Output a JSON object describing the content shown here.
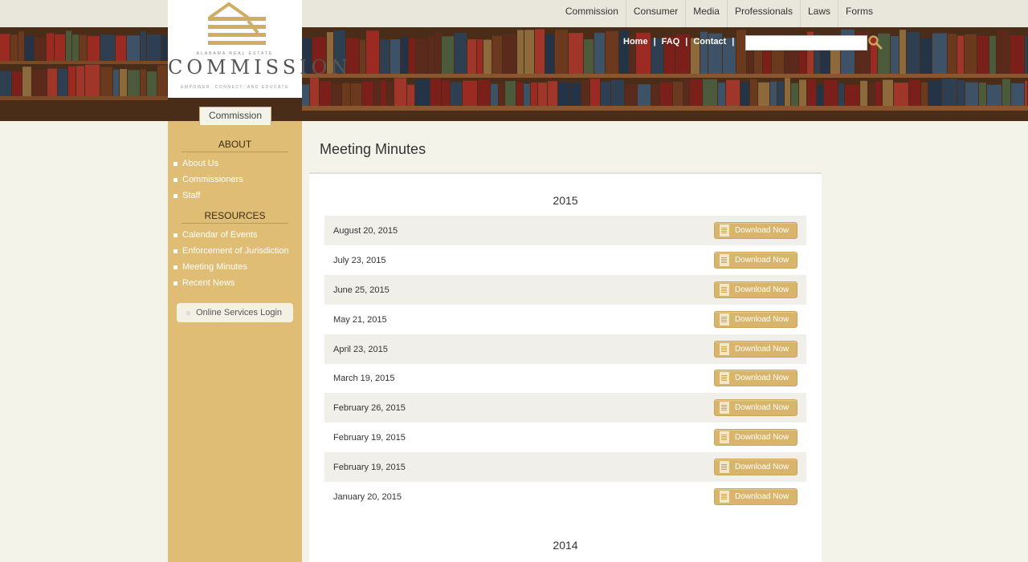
{
  "top_nav": [
    "Commission",
    "Consumer",
    "Media",
    "Professionals",
    "Laws",
    "Forms"
  ],
  "util_nav": {
    "home": "Home",
    "faq": "FAQ",
    "contact": "Contact",
    "sep": "|"
  },
  "search": {
    "value": "",
    "placeholder": ""
  },
  "logo": {
    "name": "COMMISSION",
    "subtitle": "ALABAMA REAL ESTATE",
    "tagline": "EMPOWER, CONNECT, AND EDUCATE"
  },
  "sidebar": {
    "tab": "Commission",
    "about_heading": "ABOUT",
    "about_items": [
      "About Us",
      "Commissioners",
      "Staff"
    ],
    "resources_heading": "RESOURCES",
    "resources_items": [
      "Calendar of Events",
      "Enforcement of Jurisdiction",
      "Meeting Minutes",
      "Recent News"
    ],
    "login": "Online Services Login"
  },
  "main": {
    "title": "Meeting Minutes",
    "download_label": "Download Now",
    "years": [
      {
        "year": "2015",
        "minutes": [
          "August 20, 2015",
          "July 23, 2015",
          "June 25, 2015",
          "May 21, 2015",
          "April 23, 2015",
          "March 19, 2015",
          "February 26, 2015",
          "February 19, 2015",
          "February 19, 2015",
          "January 20, 2015"
        ]
      },
      {
        "year": "2014",
        "minutes": []
      }
    ]
  },
  "colors": {
    "accent_gold": "#dfbd74",
    "button_gold": "#d9b56b",
    "page_bg": "#f4f3e9"
  }
}
